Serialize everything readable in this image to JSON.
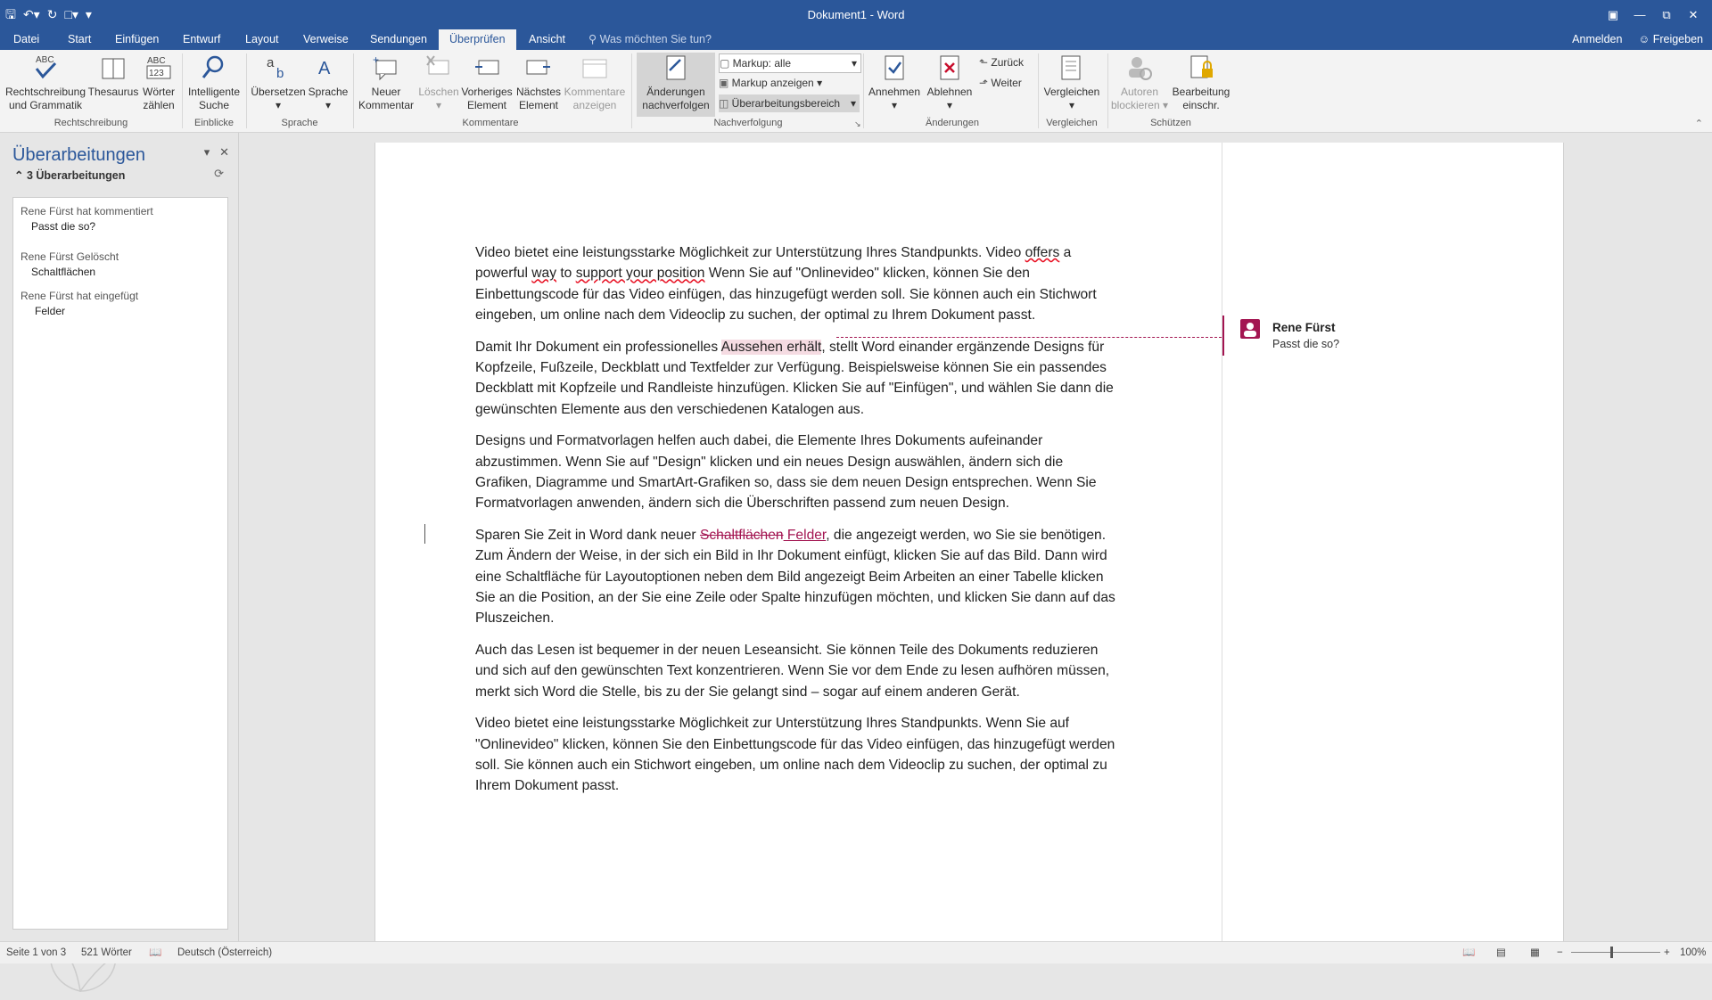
{
  "app": {
    "doc_title": "Dokument1 - Word"
  },
  "tabs": [
    "Datei",
    "Start",
    "Einfügen",
    "Entwurf",
    "Layout",
    "Verweise",
    "Sendungen",
    "Überprüfen",
    "Ansicht"
  ],
  "active_tab": "Überprüfen",
  "tell_me": "Was möchten Sie tun?",
  "account": {
    "signin": "Anmelden",
    "share": "Freigeben"
  },
  "ribbon": {
    "spelling": "Rechtschreibung und Grammatik",
    "thesaurus": "Thesaurus",
    "wordcount": "Wörter zählen",
    "smart_lookup": "Intelligente Suche",
    "translate": "Übersetzen",
    "language": "Sprache",
    "new_comment": "Neuer Kommentar",
    "delete": "Löschen",
    "previous": "Vorheriges Element",
    "next": "Nächstes Element",
    "show_comments": "Kommentare anzeigen",
    "track_changes": "Änderungen nachverfolgen",
    "markup_select": "Markup: alle",
    "show_markup": "Markup anzeigen",
    "reviewing_pane": "Überarbeitungsbereich",
    "accept": "Annehmen",
    "reject": "Ablehnen",
    "back": "Zurück",
    "forward": "Weiter",
    "compare": "Vergleichen",
    "block_authors": "Autoren blockieren",
    "restrict_editing": "Bearbeitung einschr.",
    "groups": {
      "proofing": "Rechtschreibung",
      "insights": "Einblicke",
      "language": "Sprache",
      "comments": "Kommentare",
      "tracking": "Nachverfolgung",
      "changes": "Änderungen",
      "compare": "Vergleichen",
      "protect": "Schützen"
    }
  },
  "panel": {
    "title": "Überarbeitungen",
    "count": "3 Überarbeitungen",
    "revisions": [
      {
        "header": "Rene Fürst hat kommentiert",
        "body": "Passt die so?"
      },
      {
        "header": "Rene Fürst Gelöscht",
        "body": "Schaltflächen"
      },
      {
        "header": "Rene Fürst hat eingefügt",
        "body": "Felder"
      }
    ]
  },
  "document": {
    "p1_a": "Video bietet eine leistungsstarke Möglichkeit zur Unterstützung Ihres Standpunkts. Video ",
    "p1_offers": "offers",
    "p1_b": " a powerful ",
    "p1_way": "way",
    "p1_c": " to ",
    "p1_support": "support your position",
    "p1_d": " Wenn Sie auf \"Onlinevideo\" klicken, können Sie den Einbettungscode für das Video einfügen, das hinzugefügt werden soll. Sie können auch ein Stichwort eingeben, um online nach dem Videoclip zu suchen, der optimal zu Ihrem Dokument passt.",
    "p2_a": "Damit Ihr Dokument ein professionelles ",
    "p2_hl": "Aussehen erhält",
    "p2_b": ", stellt Word einander ergänzende Designs für Kopfzeile, Fußzeile, Deckblatt und Textfelder zur Verfügung. Beispielsweise können Sie ein passendes Deckblatt mit Kopfzeile und Randleiste hinzufügen. Klicken Sie auf \"Einfügen\", und wählen Sie dann die gewünschten Elemente aus den verschiedenen Katalogen aus.",
    "p3": "Designs und Formatvorlagen helfen auch dabei, die Elemente Ihres Dokuments aufeinander abzustimmen. Wenn Sie auf \"Design\" klicken und ein neues Design auswählen, ändern sich die Grafiken, Diagramme und SmartArt-Grafiken so, dass sie dem neuen Design entsprechen. Wenn Sie Formatvorlagen anwenden, ändern sich die Überschriften passend zum neuen Design.",
    "p4_a": "Sparen Sie Zeit in Word dank neuer ",
    "p4_del": "Schaltflächen",
    "p4_ins": " Felder",
    "p4_b": ", die angezeigt werden, wo Sie sie benötigen. Zum Ändern der Weise, in der sich ein Bild in Ihr Dokument einfügt, klicken Sie auf das Bild. Dann wird eine Schaltfläche für Layoutoptionen neben dem Bild angezeigt Beim Arbeiten an einer Tabelle klicken Sie an die Position, an der Sie eine Zeile oder Spalte hinzufügen möchten, und klicken Sie dann auf das Pluszeichen.",
    "p5": "Auch das Lesen ist bequemer in der neuen Leseansicht. Sie können Teile des Dokuments reduzieren und sich auf den gewünschten Text konzentrieren. Wenn Sie vor dem Ende zu lesen aufhören müssen, merkt sich Word die Stelle, bis zu der Sie gelangt sind – sogar auf einem anderen Gerät.",
    "p6": "Video bietet eine leistungsstarke Möglichkeit zur Unterstützung Ihres Standpunkts. Wenn Sie auf \"Onlinevideo\" klicken, können Sie den Einbettungscode für das Video einfügen, das hinzugefügt werden soll. Sie können auch ein Stichwort eingeben, um online nach dem Videoclip zu suchen, der optimal zu Ihrem Dokument passt."
  },
  "comment": {
    "author": "Rene Fürst",
    "text": "Passt die so?"
  },
  "status": {
    "page": "Seite 1 von 3",
    "words": "521 Wörter",
    "language": "Deutsch (Österreich)",
    "zoom": "100%"
  },
  "colors": {
    "accent": "#2b579a",
    "revision": "#a31551"
  }
}
